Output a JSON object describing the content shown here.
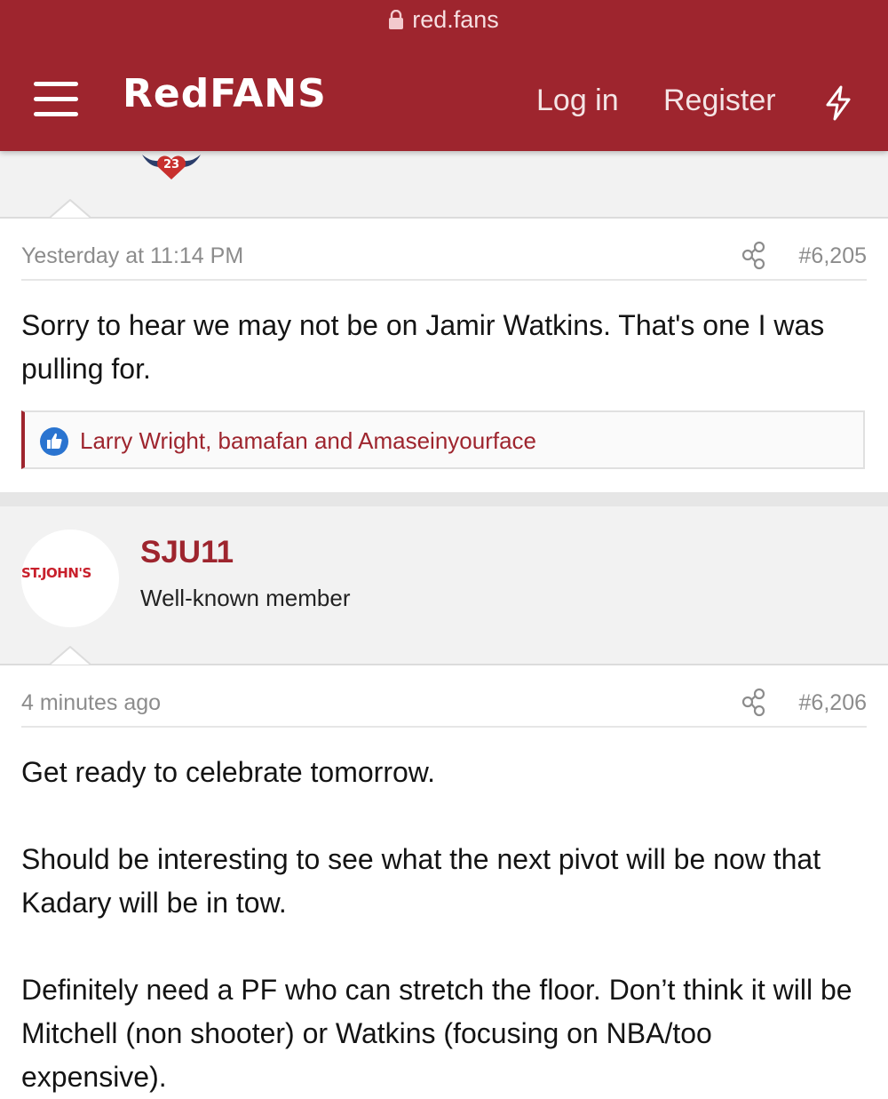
{
  "browser": {
    "url": "red.fans"
  },
  "header": {
    "logo": "RedFANS",
    "login_label": "Log in",
    "register_label": "Register",
    "brand_color": "#9e252e"
  },
  "previous_post": {
    "badge_number": "23",
    "timestamp": "Yesterday at 11:14 PM",
    "post_number": "#6,205",
    "body": "Sorry to hear we may not be on Jamir Watkins. That's one I was pulling for.",
    "reactions": "Larry Wright, bamafan and Amaseinyourface"
  },
  "post": {
    "author": "SJU11",
    "author_title": "Well-known member",
    "avatar_text": "ST.JOHN'S",
    "timestamp": "4 minutes ago",
    "post_number": "#6,206",
    "paragraphs": [
      "Get ready to celebrate tomorrow.",
      "Should be interesting to see what the next pivot will be now that Kadary will be in tow.",
      "Definitely need a PF who can stretch the floor. Don’t think it will be Mitchell (non shooter) or Watkins (focusing on NBA/too expensive)."
    ]
  }
}
